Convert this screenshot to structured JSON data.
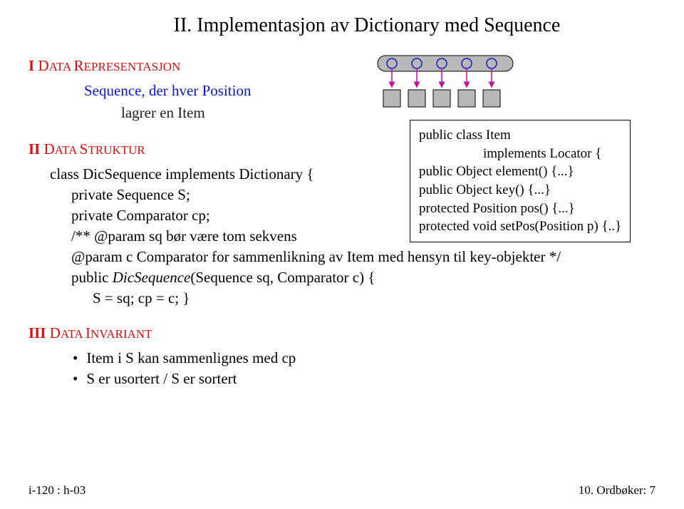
{
  "title": "II. Implementasjon av Dictionary med Sequence",
  "section1": {
    "num": "I",
    "label_prefix": " D",
    "label_rest": "ATA ",
    "word2_prefix": "R",
    "word2_rest": "EPRESENTASJON",
    "line1": "Sequence, der hver Position",
    "line2": "lagrer en Item"
  },
  "section2": {
    "num": "II",
    "label_prefix": " D",
    "label_rest": "ATA ",
    "word2_prefix": "S",
    "word2_rest": "TRUKTUR",
    "code": {
      "l1": "class DicSequence implements Dictionary {",
      "l2": "private Sequence S;",
      "l3": "private Comparator cp;",
      "l4": "/**  @param sq bør være tom sekvens",
      "l5": "       @param c Comparator for sammenlikning av Item med hensyn til key-objekter */",
      "l6_a": "public ",
      "l6_b": "DicSequence",
      "l6_c": "(Sequence sq, Comparator c) {",
      "l7": "S = sq; cp = c; }"
    }
  },
  "box": {
    "l1": "public class Item",
    "l2": "implements Locator {",
    "l3": "public Object element() {...}",
    "l4": "public Object key() {...}",
    "l5": "protected Position pos() {...}",
    "l6": "protected void setPos(Position p) {..}"
  },
  "section3": {
    "num": "III",
    "label_prefix": " D",
    "label_rest": "ATA ",
    "word2_prefix": "I",
    "word2_rest": "NVARIANT",
    "bullet1": "Item i S kan sammenlignes med cp",
    "bullet2": "S er usortert  /  S er sortert"
  },
  "footer": {
    "left": "i-120 : h-03",
    "right": "10. Ordbøker:    7"
  }
}
